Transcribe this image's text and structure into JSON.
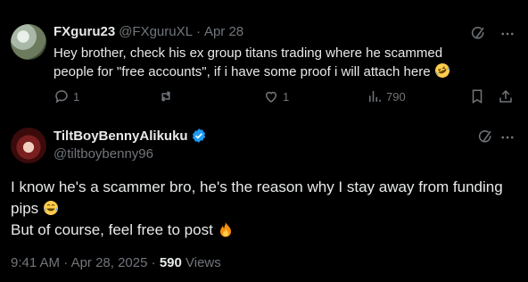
{
  "reply_post": {
    "author_name": "FXguru23",
    "handle": "@FXguruXL",
    "separator": "·",
    "date": "Apr 28",
    "text": "Hey brother, check his ex group titans trading where he scammed people for \"free accounts\", if i have some proof i will attach here",
    "emoji": "rolling-on-floor-laughing",
    "actions": {
      "replies": "1",
      "reposts": "",
      "likes": "1",
      "views": "790"
    }
  },
  "main_post": {
    "author_name": "TiltBoyBennyAlikuku",
    "handle": "@tiltboybenny96",
    "verified": true,
    "line1": "I know he's a scammer bro, he's the reason why I stay away from funding pips",
    "line1_emoji": "face-with-tears-of-joy",
    "line2": "But of course, feel free to post",
    "line2_emoji": "fire",
    "time": "9:41 AM",
    "date": "Apr 28, 2025",
    "views_count": "590",
    "views_label": "Views"
  },
  "colors": {
    "background": "#000000",
    "text": "#e7e9ea",
    "muted": "#71767b",
    "verified": "#1d9bf0"
  }
}
